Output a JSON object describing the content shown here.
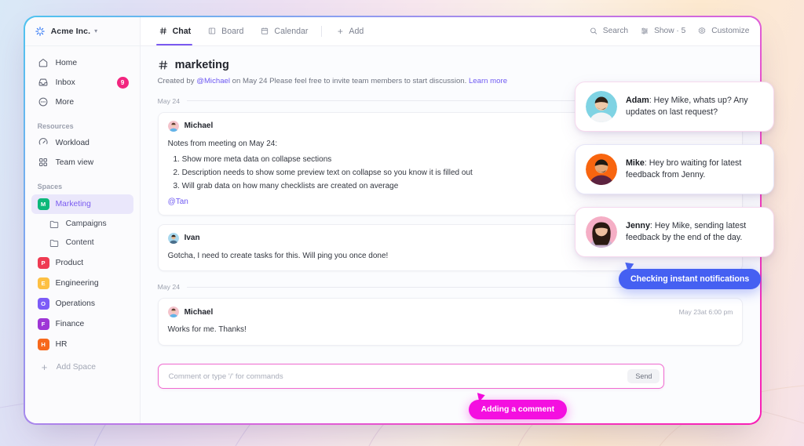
{
  "window": {
    "border_gradient": [
      "#4ec3ef",
      "#8e9cf0",
      "#de5fd8",
      "#f81fb5"
    ]
  },
  "sidebar": {
    "workspace": {
      "name": "Acme Inc.",
      "caret": "chevron-down-icon",
      "logo": "sparkle-logo-icon"
    },
    "nav": [
      {
        "label": "Home",
        "icon": "home-icon",
        "badge": ""
      },
      {
        "label": "Inbox",
        "icon": "inbox-icon",
        "badge": "9"
      },
      {
        "label": "More",
        "icon": "more-circle-icon",
        "badge": ""
      }
    ],
    "resources_title": "Resources",
    "resources": [
      {
        "label": "Workload",
        "icon": "gauge-icon"
      },
      {
        "label": "Team view",
        "icon": "grid-icon"
      }
    ],
    "spaces_title": "Spaces",
    "spaces": [
      {
        "label": "Marketing",
        "initial": "M",
        "color": "#0db87a",
        "active": true,
        "children": [
          {
            "label": "Campaigns",
            "icon": "folder-icon"
          },
          {
            "label": "Content",
            "icon": "folder-icon"
          }
        ]
      },
      {
        "label": "Product",
        "initial": "P",
        "color": "#ef3b52",
        "active": false,
        "children": []
      },
      {
        "label": "Engineering",
        "initial": "E",
        "color": "#fdc043",
        "active": false,
        "children": []
      },
      {
        "label": "Operations",
        "initial": "O",
        "color": "#7c5cf7",
        "active": false,
        "children": []
      },
      {
        "label": "Finance",
        "initial": "F",
        "color": "#9e36d6",
        "active": false,
        "children": []
      },
      {
        "label": "HR",
        "initial": "H",
        "color": "#f7681c",
        "active": false,
        "children": []
      }
    ],
    "add_space": {
      "label": "Add Space",
      "icon": "plus-icon"
    }
  },
  "topbar": {
    "tabs": [
      {
        "label": "Chat",
        "icon": "hash-icon",
        "active": true
      },
      {
        "label": "Board",
        "icon": "board-icon",
        "active": false
      },
      {
        "label": "Calendar",
        "icon": "calendar-icon",
        "active": false
      }
    ],
    "add": {
      "label": "Add",
      "icon": "plus-icon"
    },
    "actions": [
      {
        "label": "Search",
        "icon": "search-icon"
      },
      {
        "label": "Show · 5",
        "icon": "filter-icon"
      },
      {
        "label": "Customize",
        "icon": "gear-icon"
      }
    ]
  },
  "channel": {
    "hash": "#",
    "name": "marketing",
    "created_prefix": "Created by ",
    "created_by": "@Michael",
    "created_mid": " on May 24  Please feel free to invite team members to start discussion. ",
    "learn_more": "Learn more"
  },
  "conversation": {
    "day_1": "May 24",
    "day_2": "May 24",
    "messages": [
      {
        "author": "Michael",
        "avatar": "avatar-michael",
        "time": "",
        "body": "Notes from meeting on May 24:",
        "list": [
          "Show more meta data on collapse sections",
          "Description needs to show some preview text on collapse so you know it is filled out",
          "Will grab data on how many checklists are created on average"
        ],
        "footer_mention": "@Tan"
      },
      {
        "author": "Ivan",
        "avatar": "avatar-ivan",
        "time": "",
        "body": "Gotcha, I need to create tasks for this. Will ping you once done!",
        "list": [],
        "footer_mention": ""
      },
      {
        "author": "Michael",
        "avatar": "avatar-michael",
        "time": "May 23at 6:00 pm",
        "body": "Works for me. Thanks!",
        "list": [],
        "footer_mention": ""
      }
    ]
  },
  "composer": {
    "placeholder": "Comment or type '/' for commands",
    "send_label": "Send"
  },
  "callouts": {
    "comment": {
      "text": "Adding a comment",
      "color": "#f40fe0"
    },
    "notify": {
      "text": "Checking instant notifications",
      "color": "#4560f2"
    }
  },
  "floating_cards": [
    {
      "name": "Adam",
      "message": "Hey Mike, whats up? Any updates on last request?",
      "avatar_bg": "#7fd3e3",
      "skin": "#f0c9a8",
      "hair": "#2e2116"
    },
    {
      "name": "Mike",
      "message": "Hey bro waiting for latest feedback from Jenny.",
      "avatar_bg": "#f8650f",
      "skin": "#e5a878",
      "hair": "#201a14"
    },
    {
      "name": "Jenny",
      "message": "Hey Mike, sending latest feedback by the end of the day.",
      "avatar_bg": "#f5aec5",
      "skin": "#eec0a0",
      "hair": "#2a1a12"
    }
  ]
}
